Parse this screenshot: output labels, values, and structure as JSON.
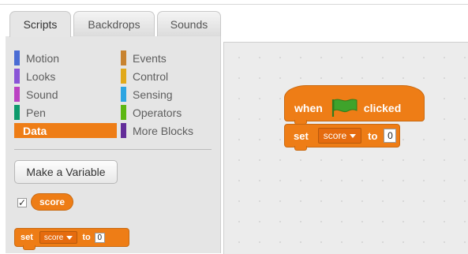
{
  "tabs": [
    {
      "label": "Scripts",
      "active": true
    },
    {
      "label": "Backdrops",
      "active": false
    },
    {
      "label": "Sounds",
      "active": false
    }
  ],
  "categories": [
    {
      "label": "Motion",
      "color": "#4a6cd4"
    },
    {
      "label": "Looks",
      "color": "#8a55d7"
    },
    {
      "label": "Sound",
      "color": "#bb42c3"
    },
    {
      "label": "Pen",
      "color": "#0e9a6c"
    },
    {
      "label": "Data",
      "color": "#ee7d16",
      "selected": true
    },
    {
      "label": "Events",
      "color": "#c88330"
    },
    {
      "label": "Control",
      "color": "#e1a91a"
    },
    {
      "label": "Sensing",
      "color": "#2ca5e2"
    },
    {
      "label": "Operators",
      "color": "#5cb712"
    },
    {
      "label": "More Blocks",
      "color": "#632d99"
    }
  ],
  "palette": {
    "make_variable_label": "Make a Variable",
    "variable_checked": true,
    "variable_name": "score",
    "set_block": {
      "keyword_set": "set",
      "variable": "score",
      "keyword_to": "to",
      "value": "0"
    }
  },
  "script": {
    "hat_when": "when",
    "hat_clicked": "clicked",
    "flag_icon": "green-flag-icon",
    "set_block": {
      "keyword_set": "set",
      "variable": "score",
      "keyword_to": "to",
      "value": "0"
    }
  },
  "colors": {
    "data_block": "#ee7d16",
    "events_block": "#c88330",
    "flag": "#3fa32b"
  }
}
